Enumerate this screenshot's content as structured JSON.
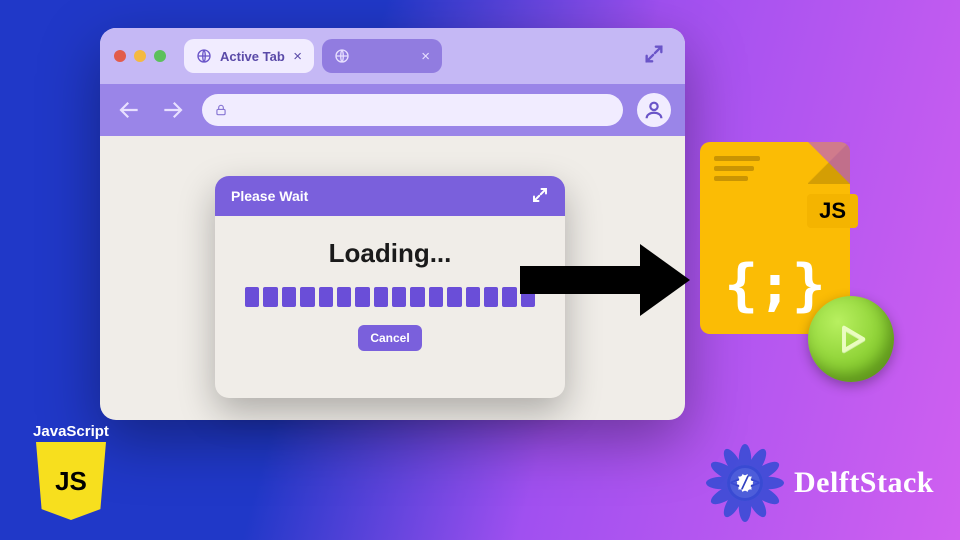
{
  "browser": {
    "tabs": [
      {
        "label": "Active Tab",
        "active": true
      },
      {
        "label": "",
        "active": false
      }
    ]
  },
  "dialog": {
    "title": "Please Wait",
    "loading_text": "Loading...",
    "cancel_label": "Cancel",
    "progress_segments": 16
  },
  "jsfile": {
    "badge": "JS",
    "braces": "{;}"
  },
  "jslogo": {
    "label": "JavaScript",
    "text": "JS"
  },
  "delftstack": {
    "name": "DelftStack",
    "core": "</>"
  }
}
